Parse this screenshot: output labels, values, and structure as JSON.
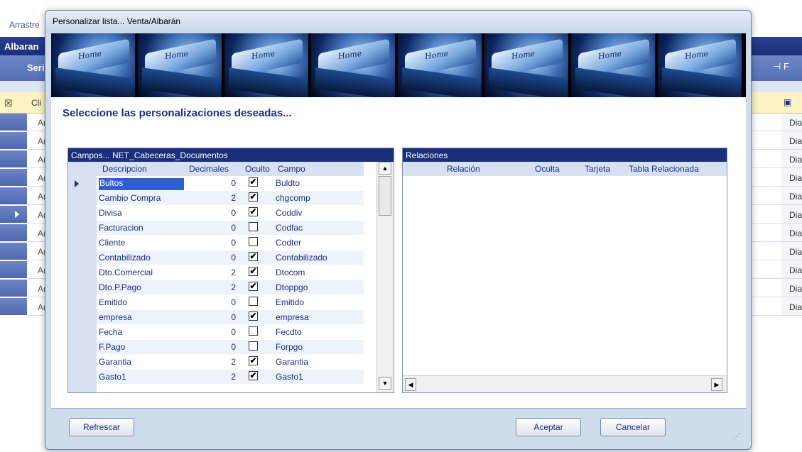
{
  "background": {
    "drag_hint": "Arrastre",
    "window_title": "Albaran",
    "column_serie": "Seri",
    "pin_glyph": "⊣ F",
    "filter_label": "Cli",
    "row_code": "A(",
    "row_day": "Dia",
    "row_count": 11
  },
  "dialog": {
    "title": "Personalizar lista... Venta/Albarán",
    "banner_text": "Home",
    "heading": "Seleccione las personalizaciones deseadas...",
    "campos": {
      "title": "Campos... NET_Cabeceras_Documentos",
      "columns": [
        "Descripcion",
        "Decimales",
        "Oculto",
        "Campo"
      ],
      "rows": [
        {
          "descripcion": "Bultos",
          "decimales": "0",
          "oculto": true,
          "campo": "Buldto"
        },
        {
          "descripcion": "Cambio Compra",
          "decimales": "2",
          "oculto": true,
          "campo": "chgcomp"
        },
        {
          "descripcion": "Divisa",
          "decimales": "0",
          "oculto": true,
          "campo": "Coddiv"
        },
        {
          "descripcion": "Facturacion",
          "decimales": "0",
          "oculto": false,
          "campo": "Codfac"
        },
        {
          "descripcion": "Cliente",
          "decimales": "0",
          "oculto": false,
          "campo": "Codter"
        },
        {
          "descripcion": "Contabilizado",
          "decimales": "0",
          "oculto": true,
          "campo": "Contabilizado"
        },
        {
          "descripcion": "Dto.Comercial",
          "decimales": "2",
          "oculto": true,
          "campo": "Dtocom"
        },
        {
          "descripcion": "Dto.P.Pago",
          "decimales": "2",
          "oculto": true,
          "campo": "Dtoppgo"
        },
        {
          "descripcion": "Emitido",
          "decimales": "0",
          "oculto": false,
          "campo": "Emitido"
        },
        {
          "descripcion": "empresa",
          "decimales": "0",
          "oculto": true,
          "campo": "empresa"
        },
        {
          "descripcion": "Fecha",
          "decimales": "0",
          "oculto": false,
          "campo": "Fecdto"
        },
        {
          "descripcion": "F.Pago",
          "decimales": "0",
          "oculto": false,
          "campo": "Forpgo"
        },
        {
          "descripcion": "Garantia",
          "decimales": "2",
          "oculto": true,
          "campo": "Garantia"
        },
        {
          "descripcion": "Gasto1",
          "decimales": "2",
          "oculto": true,
          "campo": "Gasto1"
        }
      ]
    },
    "relaciones": {
      "title": "Relaciones",
      "columns": [
        "Relación",
        "Oculta",
        "Tarjeta",
        "Tabla Relacionada"
      ]
    },
    "buttons": {
      "refrescar": "Refrescar",
      "aceptar": "Aceptar",
      "cancelar": "Cancelar"
    },
    "check_glyph": "✔"
  }
}
